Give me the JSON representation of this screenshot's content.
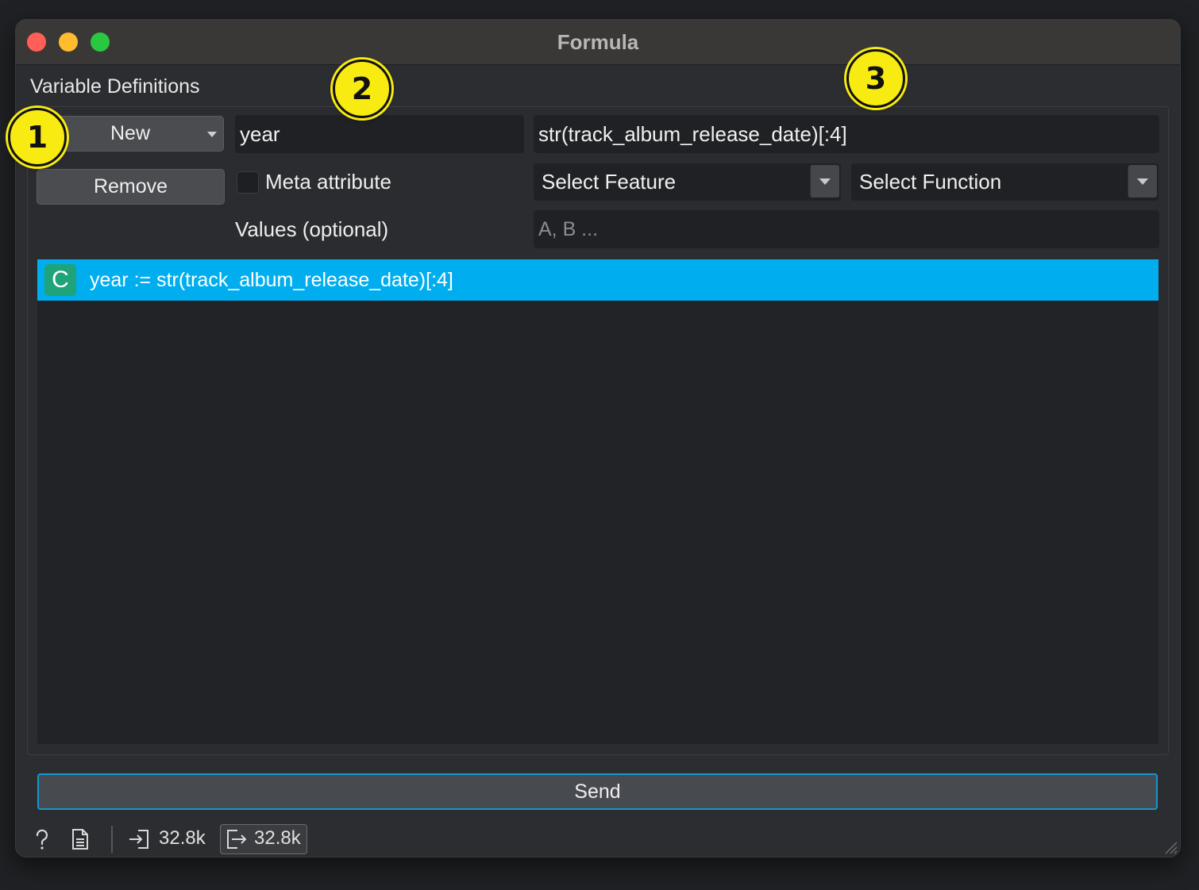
{
  "window": {
    "title": "Formula"
  },
  "section": {
    "title": "Variable Definitions"
  },
  "buttons": {
    "new_label": "New",
    "remove_label": "Remove",
    "send_label": "Send"
  },
  "editor": {
    "name_value": "year",
    "expression_value": "str(track_album_release_date)[:4]",
    "meta_label": "Meta attribute",
    "meta_checked": false,
    "values_label": "Values (optional)",
    "values_placeholder": "A, B ...",
    "feature_combo": "Select Feature",
    "function_combo": "Select Function"
  },
  "variables": [
    {
      "type_badge": "C",
      "text": "year := str(track_album_release_date)[:4]",
      "selected": true
    }
  ],
  "status": {
    "input_count": "32.8k",
    "output_count": "32.8k"
  },
  "callouts": [
    "1",
    "2",
    "3"
  ],
  "colors": {
    "selection": "#00aeef",
    "badge": "#1fa37a",
    "callout": "#f7eb12",
    "send_border": "#1497cc"
  },
  "icons": [
    "help-icon",
    "report-icon",
    "input-icon",
    "output-icon",
    "resize-grip-icon",
    "dropdown-caret-icon"
  ]
}
